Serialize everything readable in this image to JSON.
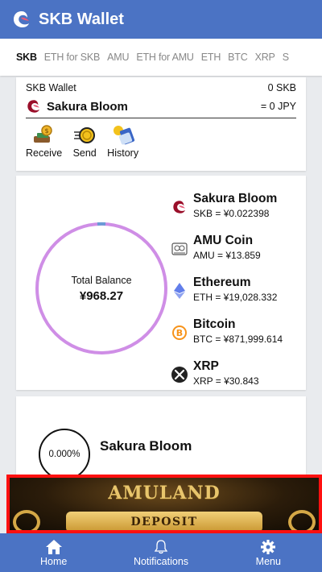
{
  "appbar": {
    "title": "SKB Wallet"
  },
  "tabs": [
    "SKB",
    "ETH for SKB",
    "AMU",
    "ETH for AMU",
    "ETH",
    "BTC",
    "XRP",
    "S"
  ],
  "wallet": {
    "label": "SKB Wallet",
    "amount": "0 SKB",
    "name": "Sakura Bloom",
    "jpy": "= 0 JPY",
    "actions": {
      "receive": "Receive",
      "send": "Send",
      "history": "History"
    }
  },
  "balance": {
    "label": "Total Balance",
    "value": "¥968.27",
    "ring_color": "#cf8ee6",
    "ring_accent": "#6b9ad6"
  },
  "coins": [
    {
      "name": "Sakura Bloom",
      "rate": "SKB = ¥0.022398",
      "icon": "sakura-icon"
    },
    {
      "name": "AMU Coin",
      "rate": "AMU = ¥13.859",
      "icon": "amu-icon"
    },
    {
      "name": "Ethereum",
      "rate": "ETH = ¥19,028.332",
      "icon": "ethereum-icon"
    },
    {
      "name": "Bitcoin",
      "rate": "BTC = ¥871,999.614",
      "icon": "bitcoin-icon"
    },
    {
      "name": "XRP",
      "rate": "XRP = ¥30.843",
      "icon": "xrp-icon"
    }
  ],
  "detail": {
    "percent": "0.000%",
    "name": "Sakura Bloom"
  },
  "banner": {
    "brand": "AMULAND",
    "cta": "DEPOSIT"
  },
  "nav": {
    "home": "Home",
    "notifications": "Notifications",
    "menu": "Menu"
  },
  "colors": {
    "primary": "#4b73c4",
    "banner_border": "#ff1010"
  }
}
